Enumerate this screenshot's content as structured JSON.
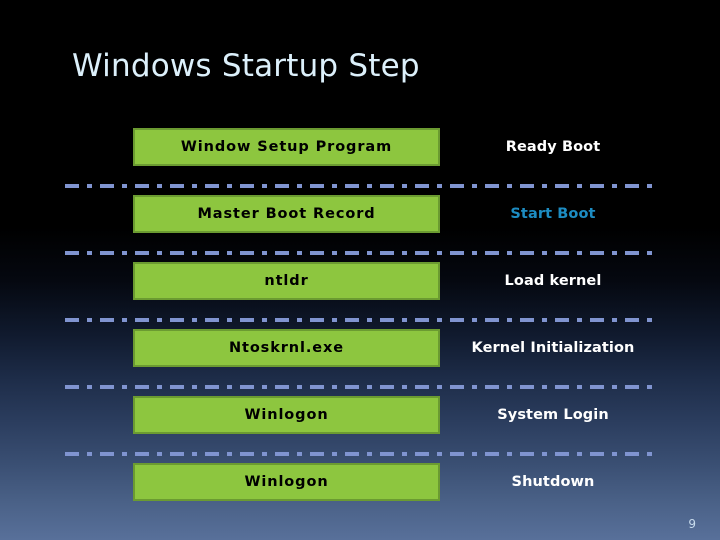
{
  "slide": {
    "title": "Windows Startup Step",
    "page_number": "9",
    "background_top_color": "#000000",
    "background_bottom_color": "#58709a",
    "title_color": "#dcf0fb",
    "box_fill_color": "#8dc63f",
    "box_border_color": "#6b9b31",
    "separator_color": "#8094d0",
    "accent_color": "#1d8cc2"
  },
  "rows": [
    {
      "box": "Window Setup Program",
      "label": "Ready Boot",
      "label_accent": false,
      "separator_above": false
    },
    {
      "box": "Master Boot Record",
      "label": "Start Boot",
      "label_accent": true,
      "separator_above": true
    },
    {
      "box": "ntldr",
      "label": "Load kernel",
      "label_accent": false,
      "separator_above": true
    },
    {
      "box": "Ntoskrnl.exe",
      "label": "Kernel Initialization",
      "label_accent": false,
      "separator_above": true
    },
    {
      "box": "Winlogon",
      "label": "System Login",
      "label_accent": false,
      "separator_above": true
    },
    {
      "box": "Winlogon",
      "label": "Shutdown",
      "label_accent": false,
      "separator_above": true
    }
  ]
}
